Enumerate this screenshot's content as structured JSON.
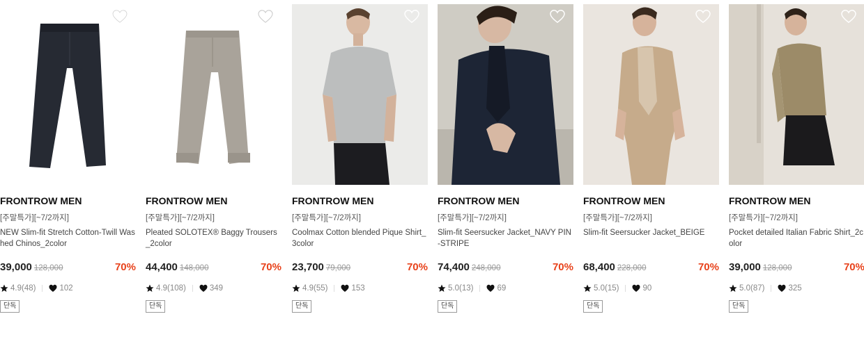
{
  "colors": {
    "discount": "#e8421b",
    "text": "#222222",
    "muted": "#888888"
  },
  "products": [
    {
      "brand": "FRONTROW MEN",
      "promo": "[주말특가][~7/2까지]",
      "name": "NEW Slim-fit Stretch Cotton-Twill Washed Chinos_2color",
      "price": "39,000",
      "original_price": "128,000",
      "discount": "70%",
      "rating": "4.9(48)",
      "likes": "102",
      "badge": "단독",
      "image": "dark navy slim chinos"
    },
    {
      "brand": "FRONTROW MEN",
      "promo": "[주말특가][~7/2까지]",
      "name": "Pleated SOLOTEX® Baggy Trousers_2color",
      "price": "44,400",
      "original_price": "148,000",
      "discount": "70%",
      "rating": "4.9(108)",
      "likes": "349",
      "badge": "단독",
      "image": "grey pleated trousers"
    },
    {
      "brand": "FRONTROW MEN",
      "promo": "[주말특가][~7/2까지]",
      "name": "Coolmax Cotton blended Pique Shirt_3color",
      "price": "23,700",
      "original_price": "79,000",
      "discount": "70%",
      "rating": "4.9(55)",
      "likes": "153",
      "badge": "단독",
      "image": "model in grey pique shirt"
    },
    {
      "brand": "FRONTROW MEN",
      "promo": "[주말특가][~7/2까지]",
      "name": "Slim-fit Seersucker Jacket_NAVY PIN-STRIPE",
      "price": "74,400",
      "original_price": "248,000",
      "discount": "70%",
      "rating": "5.0(13)",
      "likes": "69",
      "badge": "단독",
      "image": "model in navy pin-stripe jacket"
    },
    {
      "brand": "FRONTROW MEN",
      "promo": "[주말특가][~7/2까지]",
      "name": "Slim-fit Seersucker Jacket_BEIGE",
      "price": "68,400",
      "original_price": "228,000",
      "discount": "70%",
      "rating": "5.0(15)",
      "likes": "90",
      "badge": "단독",
      "image": "model in beige seersucker suit"
    },
    {
      "brand": "FRONTROW MEN",
      "promo": "[주말특가][~7/2까지]",
      "name": "Pocket detailed Italian Fabric Shirt_2color",
      "price": "39,000",
      "original_price": "128,000",
      "discount": "70%",
      "rating": "5.0(87)",
      "likes": "325",
      "badge": "단독",
      "image": "model in khaki shirt"
    }
  ]
}
